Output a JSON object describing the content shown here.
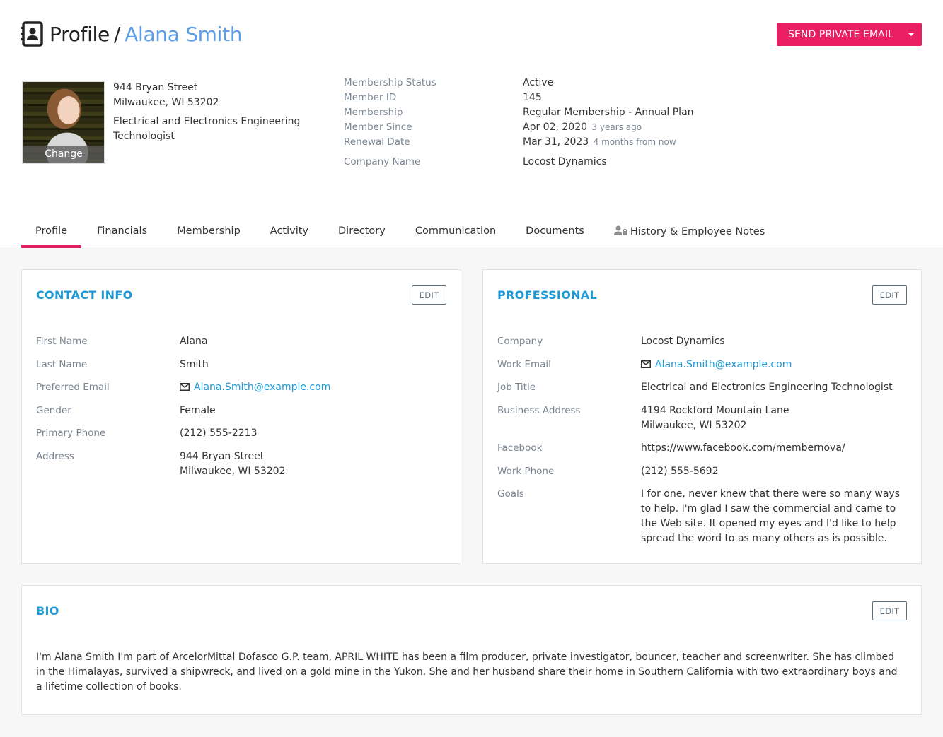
{
  "header": {
    "icon": "contact-book-icon",
    "section": "Profile",
    "separator": "/",
    "member_name": "Alana Smith",
    "send_email_label": "SEND PRIVATE EMAIL",
    "send_email_dropdown_icon": "caret-down-icon"
  },
  "colors": {
    "accent": "#eb1f64",
    "link": "#1e9ad6",
    "name": "#5b9ee6",
    "label": "#7a8591"
  },
  "summary": {
    "photo_change_label": "Change",
    "address_line1": "944 Bryan Street",
    "address_line2": "Milwaukee, WI 53202",
    "job_title": "Electrical and Electronics Engineering Technologist",
    "rows": [
      {
        "label": "Membership Status",
        "value": "Active",
        "relative": ""
      },
      {
        "label": "Member ID",
        "value": "145",
        "relative": ""
      },
      {
        "label": "Membership",
        "value": "Regular Membership - Annual Plan",
        "relative": ""
      },
      {
        "label": "Member Since",
        "value": "Apr 02, 2020",
        "relative": "3 years ago"
      },
      {
        "label": "Renewal Date",
        "value": "Mar 31, 2023",
        "relative": "4 months from now"
      },
      {
        "label": "Company Name",
        "value": "Locost Dynamics",
        "relative": ""
      }
    ]
  },
  "tabs": [
    {
      "label": "Profile",
      "active": true
    },
    {
      "label": "Financials"
    },
    {
      "label": "Membership"
    },
    {
      "label": "Activity"
    },
    {
      "label": "Directory"
    },
    {
      "label": "Communication"
    },
    {
      "label": "Documents"
    },
    {
      "label": "History & Employee Notes",
      "icon": "user-lock-icon"
    }
  ],
  "contact_info": {
    "title": "CONTACT INFO",
    "edit_label": "EDIT",
    "fields": {
      "first_name": {
        "label": "First Name",
        "value": "Alana"
      },
      "last_name": {
        "label": "Last Name",
        "value": "Smith"
      },
      "preferred_email": {
        "label": "Preferred Email",
        "value": "Alana.Smith@example.com"
      },
      "gender": {
        "label": "Gender",
        "value": "Female"
      },
      "primary_phone": {
        "label": "Primary Phone",
        "value": "(212) 555-2213"
      },
      "address": {
        "label": "Address",
        "line1": "944 Bryan Street",
        "line2": "Milwaukee, WI 53202"
      }
    }
  },
  "professional": {
    "title": "PROFESSIONAL",
    "edit_label": "EDIT",
    "fields": {
      "company": {
        "label": "Company",
        "value": "Locost Dynamics"
      },
      "work_email": {
        "label": "Work Email",
        "value": "Alana.Smith@example.com"
      },
      "job_title": {
        "label": "Job Title",
        "value": "Electrical and Electronics Engineering Technologist"
      },
      "business_address": {
        "label": "Business Address",
        "line1": "4194 Rockford Mountain Lane",
        "line2": "Milwaukee, WI 53202"
      },
      "facebook": {
        "label": "Facebook",
        "value": "https://www.facebook.com/membernova/"
      },
      "work_phone": {
        "label": "Work Phone",
        "value": "(212) 555-5692"
      },
      "goals": {
        "label": "Goals",
        "value": "I for one, never knew that there were so many ways to help. I'm glad I saw the commercial and came to the Web site. It opened my eyes and I'd like to help spread the word to as many others as is possible."
      }
    }
  },
  "bio": {
    "title": "BIO",
    "edit_label": "EDIT",
    "text": "I'm Alana Smith I'm part of ArcelorMittal Dofasco G.P. team, APRIL WHITE has been a film producer, private investigator, bouncer, teacher and screenwriter. She has climbed in the Himalayas, survived a shipwreck, and lived on a gold mine in the Yukon. She and her husband share their home in Southern California with two extraordinary boys and a lifetime collection of books."
  }
}
